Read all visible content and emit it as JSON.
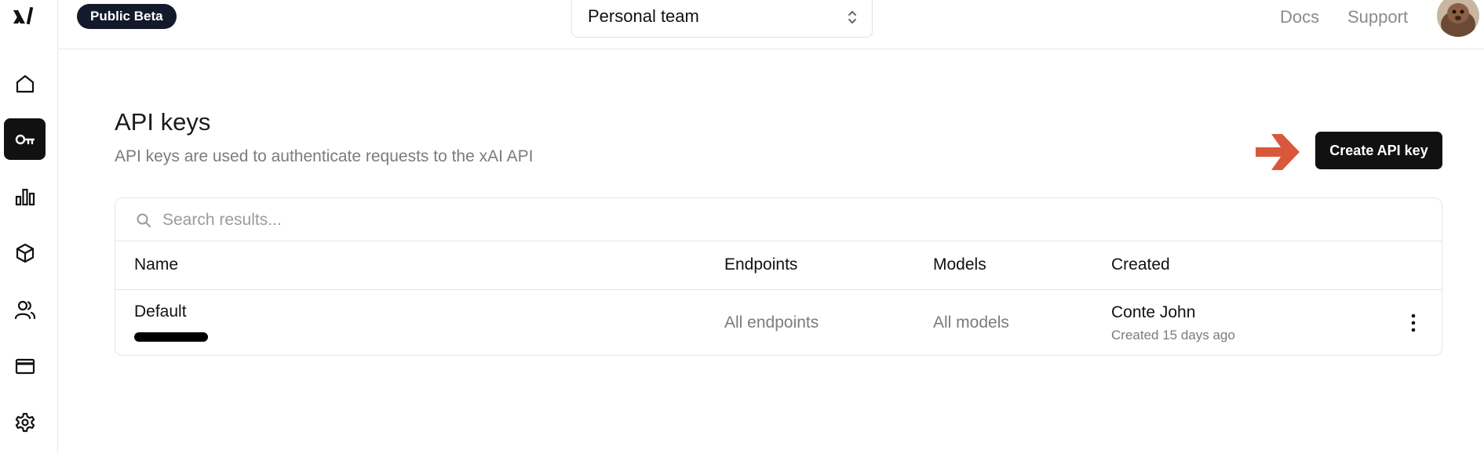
{
  "brand": {
    "logo_icon": "xai-logo-icon"
  },
  "sidebar": {
    "items": [
      {
        "name": "home",
        "icon": "home-icon",
        "active": false
      },
      {
        "name": "api-keys",
        "icon": "key-icon",
        "active": true
      },
      {
        "name": "usage",
        "icon": "bar-chart-icon",
        "active": false
      },
      {
        "name": "models",
        "icon": "cube-icon",
        "active": false
      },
      {
        "name": "team",
        "icon": "users-icon",
        "active": false
      },
      {
        "name": "billing",
        "icon": "credit-card-icon",
        "active": false
      },
      {
        "name": "settings",
        "icon": "gear-icon",
        "active": false
      }
    ]
  },
  "header": {
    "badge": "Public Beta",
    "team_select": "Personal team",
    "links": [
      "Docs",
      "Support"
    ]
  },
  "page": {
    "title": "API keys",
    "description": "API keys are used to authenticate requests to the xAI API",
    "create_button": "Create API key"
  },
  "table": {
    "search_placeholder": "Search results...",
    "columns": [
      "Name",
      "Endpoints",
      "Models",
      "Created"
    ],
    "rows": [
      {
        "name": "Default",
        "endpoints": "All endpoints",
        "models": "All models",
        "created_by": "Conte John",
        "created_ago": "Created 15 days ago"
      }
    ]
  },
  "colors": {
    "accent_dark": "#111111",
    "badge_bg": "#121a2b",
    "arrow": "#d9583b",
    "muted_text": "#7b7b80"
  }
}
